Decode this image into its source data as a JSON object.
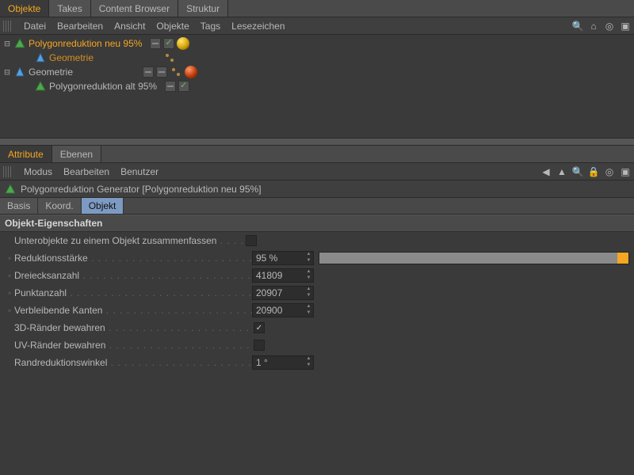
{
  "top_tabs": [
    "Objekte",
    "Takes",
    "Content Browser",
    "Struktur"
  ],
  "top_tabs_active": 0,
  "obj_menu": [
    "Datei",
    "Bearbeiten",
    "Ansicht",
    "Objekte",
    "Tags",
    "Lesezeichen"
  ],
  "tree": [
    {
      "exp": "⊟",
      "indent": 0,
      "icon": "poly",
      "label": "Polygonreduktion neu 95%",
      "sel": "sel",
      "tags": [
        "dash",
        "check"
      ],
      "extra": [
        "sphere-gold"
      ]
    },
    {
      "exp": "",
      "indent": 26,
      "icon": "cone",
      "label": "Geometrie",
      "sel": "child-sel",
      "tags": [],
      "extra": [
        "dots"
      ]
    },
    {
      "exp": "⊟",
      "indent": 0,
      "icon": "cone",
      "label": "Geometrie",
      "sel": "",
      "tags": [
        "dash",
        "dash"
      ],
      "extra": [
        "dots",
        "sphere-red"
      ]
    },
    {
      "exp": "",
      "indent": 26,
      "icon": "poly",
      "label": "Polygonreduktion alt 95%",
      "sel": "",
      "tags": [
        "dash",
        "check"
      ],
      "extra": []
    }
  ],
  "attr_tabs": [
    "Attribute",
    "Ebenen"
  ],
  "attr_tabs_active": 0,
  "attr_menu": [
    "Modus",
    "Bearbeiten",
    "Benutzer"
  ],
  "attr_header": "Polygonreduktion Generator [Polygonreduktion neu 95%]",
  "sub_tabs": [
    "Basis",
    "Koord.",
    "Objekt"
  ],
  "sub_tabs_active": 2,
  "section": "Objekt-Eigenschaften",
  "props": {
    "merge_label": "Unterobjekte zu einem Objekt zusammenfassen",
    "merge_checked": false,
    "reduction_label": "Reduktionsstärke",
    "reduction_value": "95 %",
    "tris_label": "Dreiecksanzahl",
    "tris_value": "41809",
    "points_label": "Punktanzahl",
    "points_value": "20907",
    "edges_label": "Verbleibende Kanten",
    "edges_value": "20900",
    "keep3d_label": "3D-Ränder bewahren",
    "keep3d_checked": true,
    "keepuv_label": "UV-Ränder bewahren",
    "keepuv_checked": false,
    "angle_label": "Randreduktionswinkel",
    "angle_value": "1 °"
  }
}
